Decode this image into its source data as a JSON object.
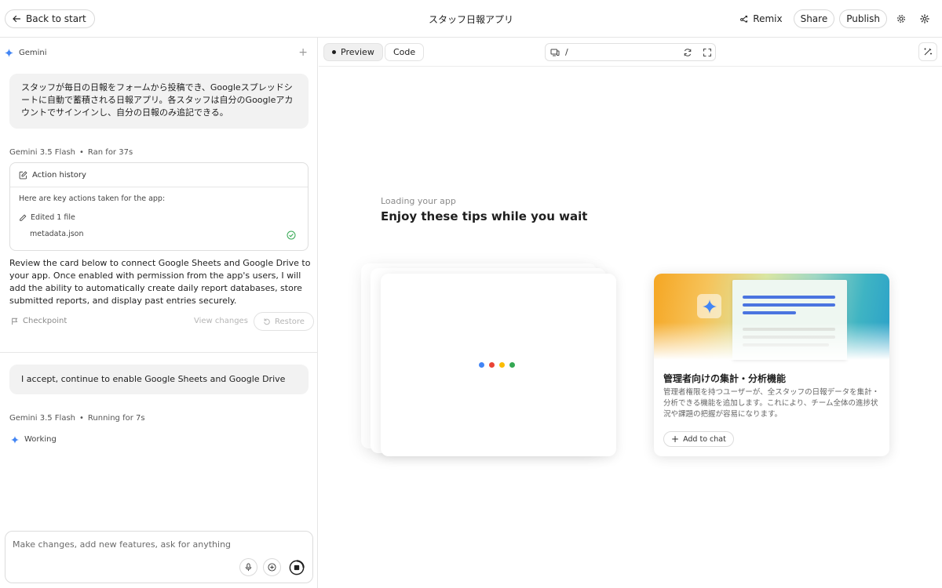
{
  "header": {
    "back_label": "Back to start",
    "title": "スタッフ日報アプリ",
    "remix_label": "Remix",
    "share_label": "Share",
    "publish_label": "Publish"
  },
  "sidebar": {
    "model_name": "Gemini",
    "user_prompt_1": "スタッフが毎日の日報をフォームから投稿でき、Googleスプレッドシートに自動で蓄積される日報アプリ。各スタッフは自分のGoogleアカウントでサインインし、自分の日報のみ追記できる。",
    "meta_1_model": "Gemini 3.5 Flash",
    "meta_1_status": "Ran for 37s",
    "action_history_label": "Action history",
    "action_intro": "Here are key actions taken for the app:",
    "edited_label": "Edited 1 file",
    "file_name": "metadata.json",
    "response_text": "Review the card below to connect Google Sheets and Google Drive to your app. Once enabled with permission from the app's users, I will add the ability to automatically create daily report databases, store submitted reports, and display past entries securely.",
    "checkpoint_label": "Checkpoint",
    "view_changes_label": "View changes",
    "restore_label": "Restore",
    "user_prompt_2": "I accept, continue to enable Google Sheets and Google Drive",
    "meta_2_model": "Gemini 3.5 Flash",
    "meta_2_status": "Running for 7s",
    "working_label": "Working",
    "composer_placeholder": "Make changes, add new features, ask for anything"
  },
  "preview": {
    "tab_preview": "Preview",
    "tab_code": "Code",
    "url_path": "/",
    "loading_text": "Loading your app",
    "tips_title": "Enjoy these tips while you wait",
    "tip_card": {
      "title": "管理者向けの集計・分析機能",
      "description": "管理者権限を持つユーザーが、全スタッフの日報データを集計・分析できる機能を追加します。これにより、チーム全体の進捗状況や課題の把握が容易になります。",
      "add_label": "Add to chat"
    }
  },
  "colors": {
    "gemini_blue": "#4285f4",
    "google_red": "#ea4335",
    "google_yellow": "#fbbc04",
    "google_green": "#34a853",
    "success_green": "#34a853"
  },
  "icons": [
    "arrow-left-icon",
    "remix-icon",
    "settings-icon",
    "gear-icon",
    "sparkle-icon",
    "plus-icon",
    "edit-square-icon",
    "pencil-icon",
    "check-circle-icon",
    "flag-icon",
    "restore-icon",
    "mic-icon",
    "add-circle-icon",
    "stop-icon",
    "device-icon",
    "refresh-icon",
    "fullscreen-icon",
    "magic-edit-icon"
  ]
}
